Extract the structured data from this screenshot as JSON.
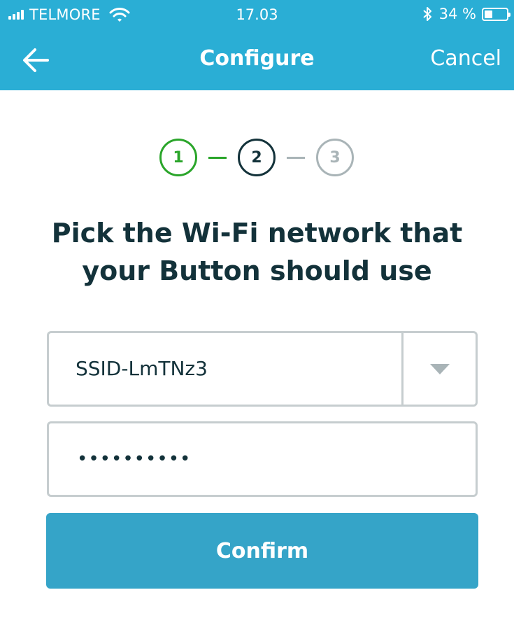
{
  "status_bar": {
    "carrier": "TELMORE",
    "time": "17.03",
    "battery_text": "34 %",
    "battery_level": 0.34
  },
  "nav": {
    "title": "Configure",
    "cancel_label": "Cancel",
    "back_icon": "arrow-left-icon"
  },
  "stepper": {
    "steps": [
      "1",
      "2",
      "3"
    ],
    "current_step": 2
  },
  "heading": "Pick the Wi-Fi network that your Button should use",
  "network_select": {
    "value": "SSID-LmTNz3"
  },
  "password": {
    "masked_value": "••••••••••"
  },
  "confirm_label": "Confirm",
  "colors": {
    "header": "#2aaed5",
    "step_done": "#2aa52a",
    "step_current": "#13323a",
    "step_todo": "#a9b4b7",
    "button": "#35a4c8"
  }
}
